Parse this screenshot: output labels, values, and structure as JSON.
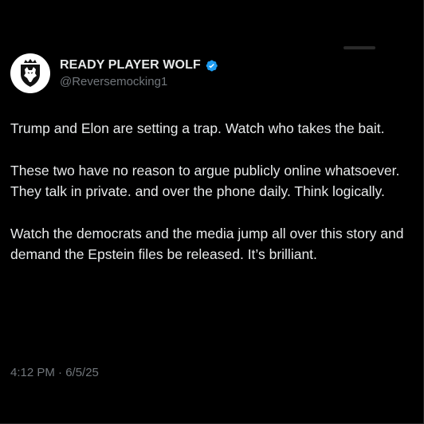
{
  "tweet": {
    "display_name": "READY PLAYER WOLF",
    "handle": "@Reversemocking1",
    "verified": true,
    "paragraphs": [
      "Trump and Elon are setting a trap. Watch who takes the bait.",
      "These two have no reason to argue publicly online whatsoever. They talk in private. and over the phone daily. Think logically.",
      "Watch the democrats and the media jump all over this story and demand the Epstein files be released. It’s brilliant."
    ],
    "timestamp": "4:12 PM · 6/5/25"
  },
  "icons": {
    "avatar": "wolf-shield-logo",
    "verified": "verified-badge-icon"
  },
  "colors": {
    "background": "#000000",
    "text": "#e7e9ea",
    "muted": "#71767b",
    "verified": "#1d9bf0"
  }
}
